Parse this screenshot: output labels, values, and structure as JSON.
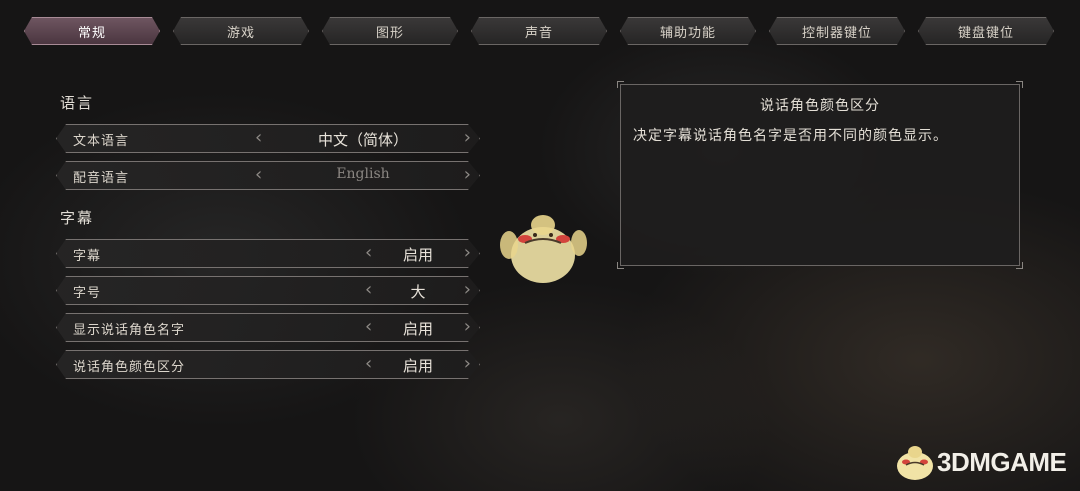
{
  "tabs": [
    {
      "label": "常规",
      "active": true
    },
    {
      "label": "游戏",
      "active": false
    },
    {
      "label": "图形",
      "active": false
    },
    {
      "label": "声音",
      "active": false
    },
    {
      "label": "辅助功能",
      "active": false
    },
    {
      "label": "控制器键位",
      "active": false
    },
    {
      "label": "键盘键位",
      "active": false
    }
  ],
  "sections": {
    "language": {
      "title": "语言",
      "rows": [
        {
          "label": "文本语言",
          "value": "中文（简体）"
        },
        {
          "label": "配音语言",
          "value": "English"
        }
      ]
    },
    "subtitles": {
      "title": "字幕",
      "rows": [
        {
          "label": "字幕",
          "value": "启用"
        },
        {
          "label": "字号",
          "value": "大"
        },
        {
          "label": "显示说话角色名字",
          "value": "启用"
        },
        {
          "label": "说话角色颜色区分",
          "value": "启用"
        }
      ]
    }
  },
  "description": {
    "title": "说话角色颜色区分",
    "body": "决定字幕说话角色名字是否用不同的颜色显示。"
  },
  "watermark": {
    "text": "3DMGAME"
  },
  "colors": {
    "active_tab": "#5e4550",
    "panel_border": "#6a6664",
    "background": "#161515"
  }
}
